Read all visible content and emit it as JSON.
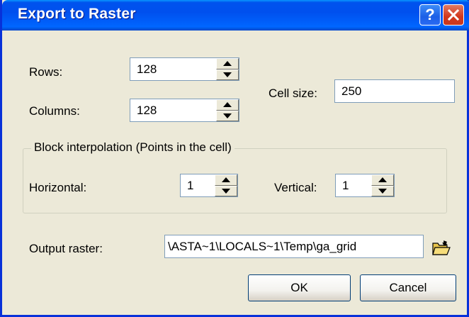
{
  "window": {
    "title": "Export to Raster",
    "help_glyph": "?",
    "close_icon": "close-icon"
  },
  "grid": {
    "rows_label": "Rows:",
    "rows_value": "128",
    "columns_label": "Columns:",
    "columns_value": "128",
    "cell_size_label": "Cell size:",
    "cell_size_value": "250"
  },
  "block_interpolation": {
    "group_title": "Block interpolation (Points in the cell)",
    "horizontal_label": "Horizontal:",
    "horizontal_value": "1",
    "vertical_label": "Vertical:",
    "vertical_value": "1"
  },
  "output": {
    "label": "Output raster:",
    "value": "\\ASTA~1\\LOCALS~1\\Temp\\ga_grid",
    "browse_icon": "folder-open-icon"
  },
  "buttons": {
    "ok": "OK",
    "cancel": "Cancel"
  }
}
